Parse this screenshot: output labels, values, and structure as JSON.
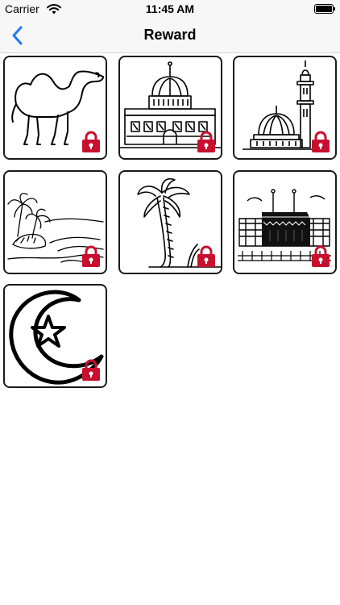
{
  "status_bar": {
    "carrier": "Carrier",
    "time": "11:45 AM"
  },
  "nav": {
    "title": "Reward",
    "back_icon": "chevron-left-icon",
    "accent": "#1e7bf2"
  },
  "lock_color": "#c8102e",
  "rewards": [
    {
      "subject": "camel",
      "locked": true
    },
    {
      "subject": "dome-of-the-rock",
      "locked": true
    },
    {
      "subject": "green-dome-mosque",
      "locked": true
    },
    {
      "subject": "oasis-palms",
      "locked": true
    },
    {
      "subject": "palm-tree",
      "locked": true
    },
    {
      "subject": "kaaba",
      "locked": true
    },
    {
      "subject": "crescent-star",
      "locked": true
    }
  ]
}
